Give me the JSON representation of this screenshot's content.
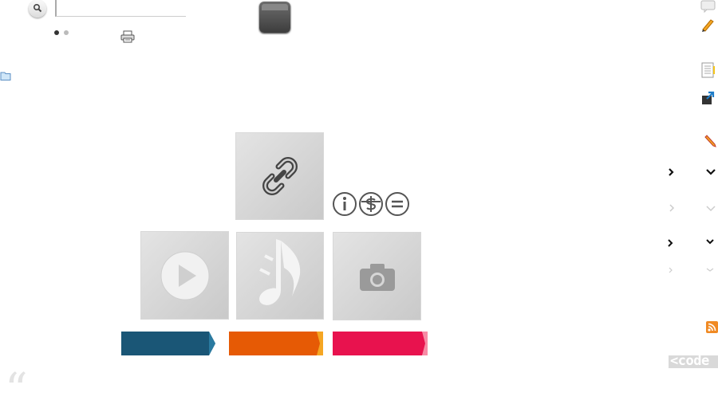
{
  "search": {
    "placeholder": ""
  },
  "pagination": {
    "dots": 2,
    "active": 1
  },
  "ribbons": [
    {
      "label": "",
      "color": "#1a5676",
      "tip": "#2a7aa0"
    },
    {
      "label": "",
      "color": "#e65a05",
      "tip": "#f5a623"
    },
    {
      "label": "",
      "color": "#e8124e",
      "tip": "#f78ba5"
    }
  ],
  "license": {
    "icons": [
      "attribution-icon",
      "non-commercial-icon",
      "no-derivatives-icon"
    ]
  },
  "tiles": [
    "link-icon",
    "play-icon",
    "music-note-icon",
    "camera-icon"
  ],
  "code_badge": {
    "label": "<code"
  },
  "quote_mark": "“"
}
